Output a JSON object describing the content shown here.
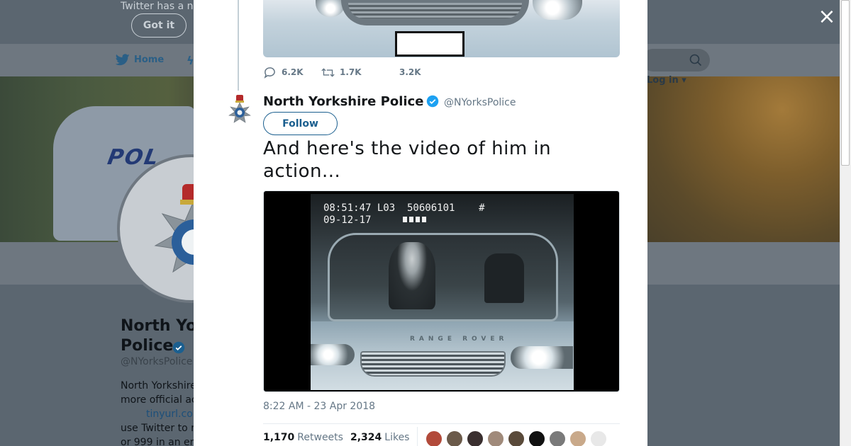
{
  "background": {
    "banner_text": "Twitter has a n",
    "got_it": "Got it",
    "nav_home": "Home",
    "login": "Log in",
    "car_text": "POL",
    "profile_name_line1": "North Yo",
    "profile_name_line2": "Police",
    "profile_handle": "@NYorksPolice",
    "bio_line1": "North Yorkshire",
    "bio_line2": "more official ac",
    "bio_link": "tinyurl.co",
    "bio_line4": "use Twitter to r",
    "bio_line5": "or 999 in an en"
  },
  "close_label": "×",
  "previous_tweet": {
    "replies": "6.2K",
    "retweets": "1.7K",
    "likes": "3.2K"
  },
  "tweet": {
    "name": "North Yorkshire Police",
    "handle": "@NYorksPolice",
    "follow": "Follow",
    "text": "And here's the video of him in action...",
    "video_osd_line1": "08:51:47 L03  50606101    #",
    "video_osd_line2": "09-12-17",
    "bonnet_text": "RANGE ROVER",
    "timestamp": "8:22 AM - 23 Apr 2018",
    "retweets_count": "1,170",
    "retweets_label": "Retweets",
    "likes_count": "2,324",
    "likes_label": "Likes"
  },
  "colors": {
    "accent": "#1da1f2",
    "follow_blue": "#1b5f8f",
    "muted": "#657786",
    "overlay_bg": "#2b3a44"
  },
  "liker_colors": [
    "#b24a3a",
    "#6b5a4a",
    "#3a2f2f",
    "#a08a7a",
    "#5a4a3a",
    "#111111",
    "#7a7a7a",
    "#c9a98a",
    "#e8e8e8"
  ]
}
